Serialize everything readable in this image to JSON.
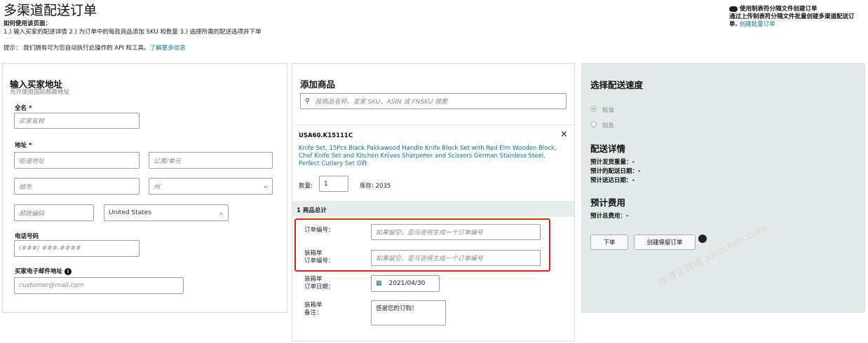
{
  "page": {
    "title": "多渠道配送订单",
    "howto_label": "如何使用该页面：",
    "steps": "1.) 输入买家的配送详情 2.) 为订单中的每款商品添加 SKU 和数量 3.) 选择所需的配送选项并下单",
    "tip_prefix": "提示： 我们拥有可为您自动执行此操作的 API 和工具。",
    "tip_link": "了解更多信息"
  },
  "bulk": {
    "heading": "使用制表符分隔文件创建订单",
    "text": "通过上传制表符分隔文件批量创建多渠道配送订",
    "text2": "单. ",
    "link": "创建批量订单"
  },
  "address": {
    "heading": "输入买家地址",
    "subtitle": "允许使用国际邮政地址",
    "fullname_label": "全名 *",
    "fullname_placeholder": "买家名称",
    "address_label": "地址 *",
    "street_placeholder": "街道地址",
    "apt_placeholder": "公寓/单元",
    "city_placeholder": "城市",
    "state_placeholder": "州",
    "zip_placeholder": "邮政编码",
    "country_value": "United States",
    "phone_label": "电话号码",
    "phone_placeholder": "(###) ###-####",
    "email_label": "买家电子邮件地址",
    "email_placeholder": "customer@mail.com"
  },
  "products": {
    "heading": "添加商品",
    "search_placeholder": "按商品名称、卖家 SKU、ASIN 或 FNSKU 搜索",
    "item_sku": "USA60.K15111C",
    "item_title": "Knife Set, 15Pcs Black Pakkawood Handle Knife Block Set with Red Elm Wooden Block, Chef Knife Set and Kitchen Knives Sharpener and Scissors German Stainless Steel, Perfect Cutlery Set Gift",
    "qty_label": "数量:",
    "qty_value": "1",
    "stock_label": "库存:",
    "stock_value": "2035",
    "total_label": "1 商品总计",
    "order_no_label": "订单编号：",
    "order_no_placeholder": "如果留空，亚马逊将生成一个订单编号",
    "packing_no_label1": "装箱单",
    "packing_no_label2": "订单编号：",
    "packing_no_placeholder": "如果留空，亚马逊将生成一个订单编号",
    "packing_date_label1": "装箱单",
    "packing_date_label2": "订单日期：",
    "packing_date_value": "2021/04/30",
    "note_label1": "装箱单",
    "note_label2": "备注：",
    "note_value": "感谢您的订购！"
  },
  "shipping": {
    "heading": "选择配送速度",
    "option_standard": "标准",
    "option_expedited": "加急",
    "details_heading": "配送详情",
    "ship_weight": "预计发货重量：-",
    "ship_date": "预计的配送日期：-",
    "arrive_date": "预计送达日期：-",
    "cost_heading": "预计费用",
    "total_cost": "预计总费用：-",
    "place_order": "下单",
    "create_hold": "创建保留订单"
  },
  "watermark": "陈博谈跨境 amzchen.com",
  "colors": {
    "accent_link": "#0a7b8a",
    "highlight_box": "#dd2222",
    "right_panel_bg": "#e3eae9"
  }
}
